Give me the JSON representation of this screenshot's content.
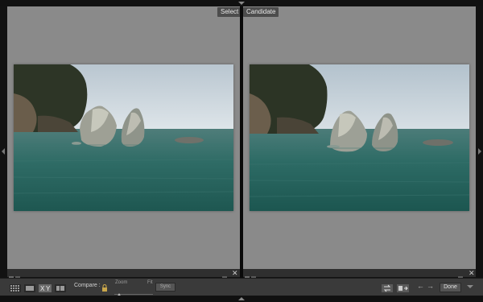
{
  "panes": {
    "left": {
      "label": "Select"
    },
    "right": {
      "label": "Candidate"
    }
  },
  "toolbar": {
    "compare_label": "Compare :",
    "zoom_label": "Zoom",
    "fit_label": "Fit",
    "sync_label": "Sync",
    "done_label": "Done",
    "view_buttons": [
      "grid-view-icon",
      "loupe-view-icon",
      "compare-view-icon",
      "survey-view-icon"
    ]
  },
  "colors": {
    "pane_bg": "#8a8a8a",
    "app_bg": "#121212",
    "toolbar_bg": "#3a3a3a",
    "label_bg": "#4d4d4d"
  }
}
